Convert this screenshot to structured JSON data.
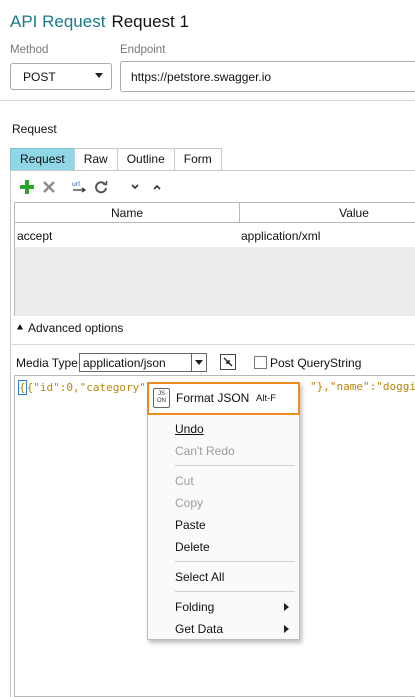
{
  "header": {
    "brand": "API Request",
    "request_name": "Request 1"
  },
  "method": {
    "label": "Method",
    "value": "POST"
  },
  "endpoint": {
    "label": "Endpoint",
    "value": "https://petstore.swagger.io"
  },
  "request_section": {
    "label": "Request"
  },
  "tabs": [
    {
      "label": "Request",
      "active": true
    },
    {
      "label": "Raw",
      "active": false
    },
    {
      "label": "Outline",
      "active": false
    },
    {
      "label": "Form",
      "active": false
    }
  ],
  "toolbar": {
    "icons": [
      "add-icon",
      "delete-icon",
      "encode-icon",
      "refresh-icon",
      "chevron-down-icon",
      "chevron-up-icon"
    ]
  },
  "headers_grid": {
    "columns": [
      "Name",
      "Value"
    ],
    "rows": [
      {
        "name": "accept",
        "value": "application/xml"
      }
    ]
  },
  "advanced": {
    "label": "Advanced options",
    "icon": "chevron-up-icon"
  },
  "media": {
    "label": "Media Type",
    "value": "application/json",
    "post_querystring_label": "Post QueryString",
    "post_querystring_checked": false
  },
  "editor": {
    "left_text": "{\"id\":0,\"category\"",
    "right_text": "\"},\"name\":\"doggi"
  },
  "context_menu": {
    "items": [
      {
        "label": "Format JSON",
        "shortcut": "Alt-F",
        "icon": "json-icon",
        "enabled": true,
        "highlighted": true
      },
      {
        "label": "Undo",
        "enabled": true
      },
      {
        "label": "Can't Redo",
        "enabled": false
      },
      {
        "label": "Cut",
        "enabled": false
      },
      {
        "label": "Copy",
        "enabled": false
      },
      {
        "label": "Paste",
        "enabled": true
      },
      {
        "label": "Delete",
        "enabled": true
      },
      {
        "label": "Select All",
        "enabled": true
      },
      {
        "label": "Folding",
        "enabled": true,
        "submenu": true
      },
      {
        "label": "Get Data",
        "enabled": true,
        "submenu": true
      }
    ]
  },
  "colors": {
    "brand": "#1a7a8a",
    "active_tab": "#8fd6e6",
    "highlight_border": "#ef8a1e",
    "json_text": "#b8860b"
  }
}
